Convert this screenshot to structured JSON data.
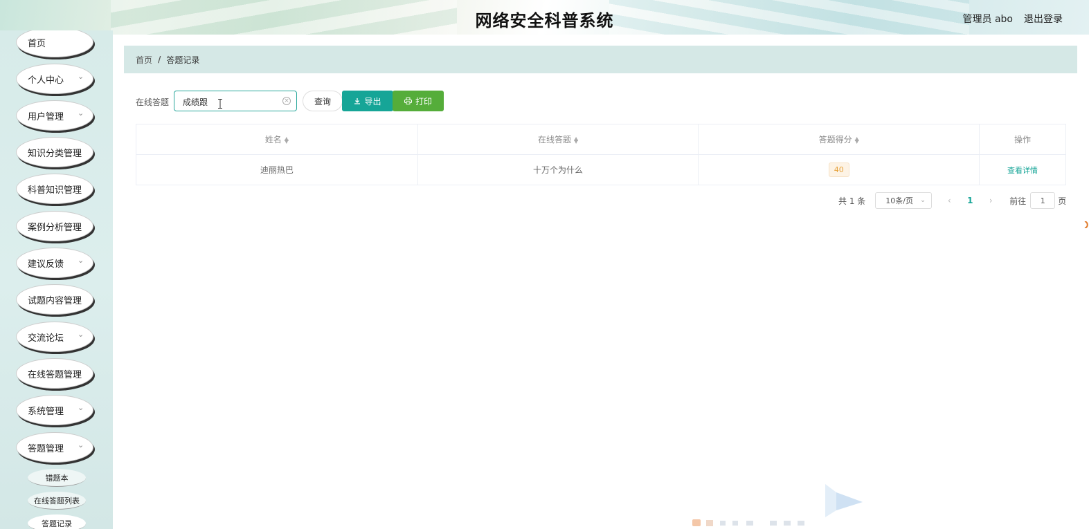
{
  "header": {
    "title": "网络安全科普系统",
    "user": "管理员 abo",
    "logout": "退出登录"
  },
  "sidebar": {
    "items": [
      {
        "label": "首页",
        "has_arrow": false
      },
      {
        "label": "个人中心",
        "has_arrow": true
      },
      {
        "label": "用户管理",
        "has_arrow": true
      },
      {
        "label": "知识分类管理",
        "has_arrow": false
      },
      {
        "label": "科普知识管理",
        "has_arrow": false
      },
      {
        "label": "案例分析管理",
        "has_arrow": false
      },
      {
        "label": "建议反馈",
        "has_arrow": true
      },
      {
        "label": "试题内容管理",
        "has_arrow": false
      },
      {
        "label": "交流论坛",
        "has_arrow": true
      },
      {
        "label": "在线答题管理",
        "has_arrow": false
      },
      {
        "label": "系统管理",
        "has_arrow": true
      },
      {
        "label": "答题管理",
        "has_arrow": true
      }
    ],
    "sub_items": [
      {
        "label": "错题本"
      },
      {
        "label": "在线答题列表"
      },
      {
        "label": "答题记录",
        "active": true
      }
    ]
  },
  "breadcrumb": {
    "home": "首页",
    "separator": "/",
    "current": "答题记录"
  },
  "search": {
    "label": "在线答题",
    "value": "成绩跟"
  },
  "buttons": {
    "query": "查询",
    "export": "导出",
    "print": "打印"
  },
  "table": {
    "columns": [
      "姓名",
      "在线答题",
      "答题得分",
      "操作"
    ],
    "rows": [
      {
        "name": "迪丽热巴",
        "quiz": "十万个为什么",
        "score": "40",
        "action": "查看详情"
      }
    ]
  },
  "pagination": {
    "total": "共 1 条",
    "page_size": "10条/页",
    "current_page": "1",
    "goto_label": "前往",
    "goto_value": "1",
    "goto_suffix": "页"
  },
  "colors": {
    "accent": "#16a597",
    "print": "#55ad3a",
    "sidebar_bg": "#d7ebe9",
    "breadcrumb_bg": "#d5e8e6",
    "score_badge": "#e6a23c"
  }
}
